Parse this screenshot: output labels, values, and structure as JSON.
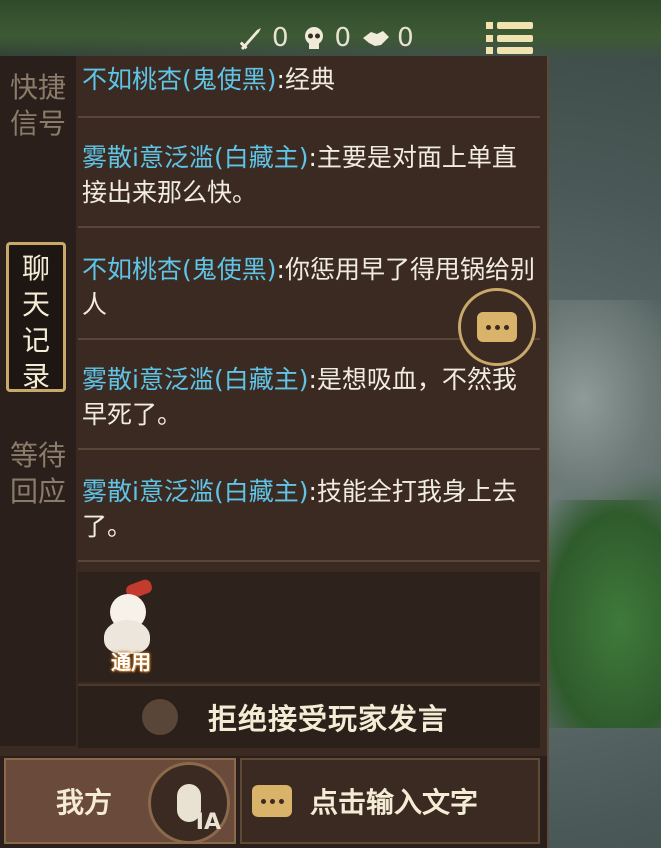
{
  "top_stats": {
    "kills": "0",
    "deaths": "0",
    "assists": "0"
  },
  "side_tabs": [
    {
      "label": "快捷信号",
      "active": false
    },
    {
      "label": "聊天记录",
      "active": true
    },
    {
      "label": "等待回应",
      "active": false
    }
  ],
  "messages": [
    {
      "name": "不如桃杏(鬼使黑)",
      "text": ":经典"
    },
    {
      "name": "雾散i意泛滥(白藏主)",
      "text": ":主要是对面上单直接出来那么快。"
    },
    {
      "name": "不如桃杏(鬼使黑)",
      "text": ":你惩用早了得甩锅给别人"
    },
    {
      "name": "雾散i意泛滥(白藏主)",
      "text": ":是想吸血，不然我早死了。"
    },
    {
      "name": "雾散i意泛滥(白藏主)",
      "text": ":技能全打我身上去了。"
    }
  ],
  "sticker": {
    "label": "通用"
  },
  "reject_option": {
    "label": "拒绝接受玩家发言"
  },
  "bottom": {
    "team_label": "我方",
    "voice_label": "IA",
    "input_placeholder": "点击输入文字"
  },
  "colors": {
    "name_color": "#5fc4e6",
    "accent_gold": "#c8a96a",
    "panel_bg": "#3a2a22"
  }
}
